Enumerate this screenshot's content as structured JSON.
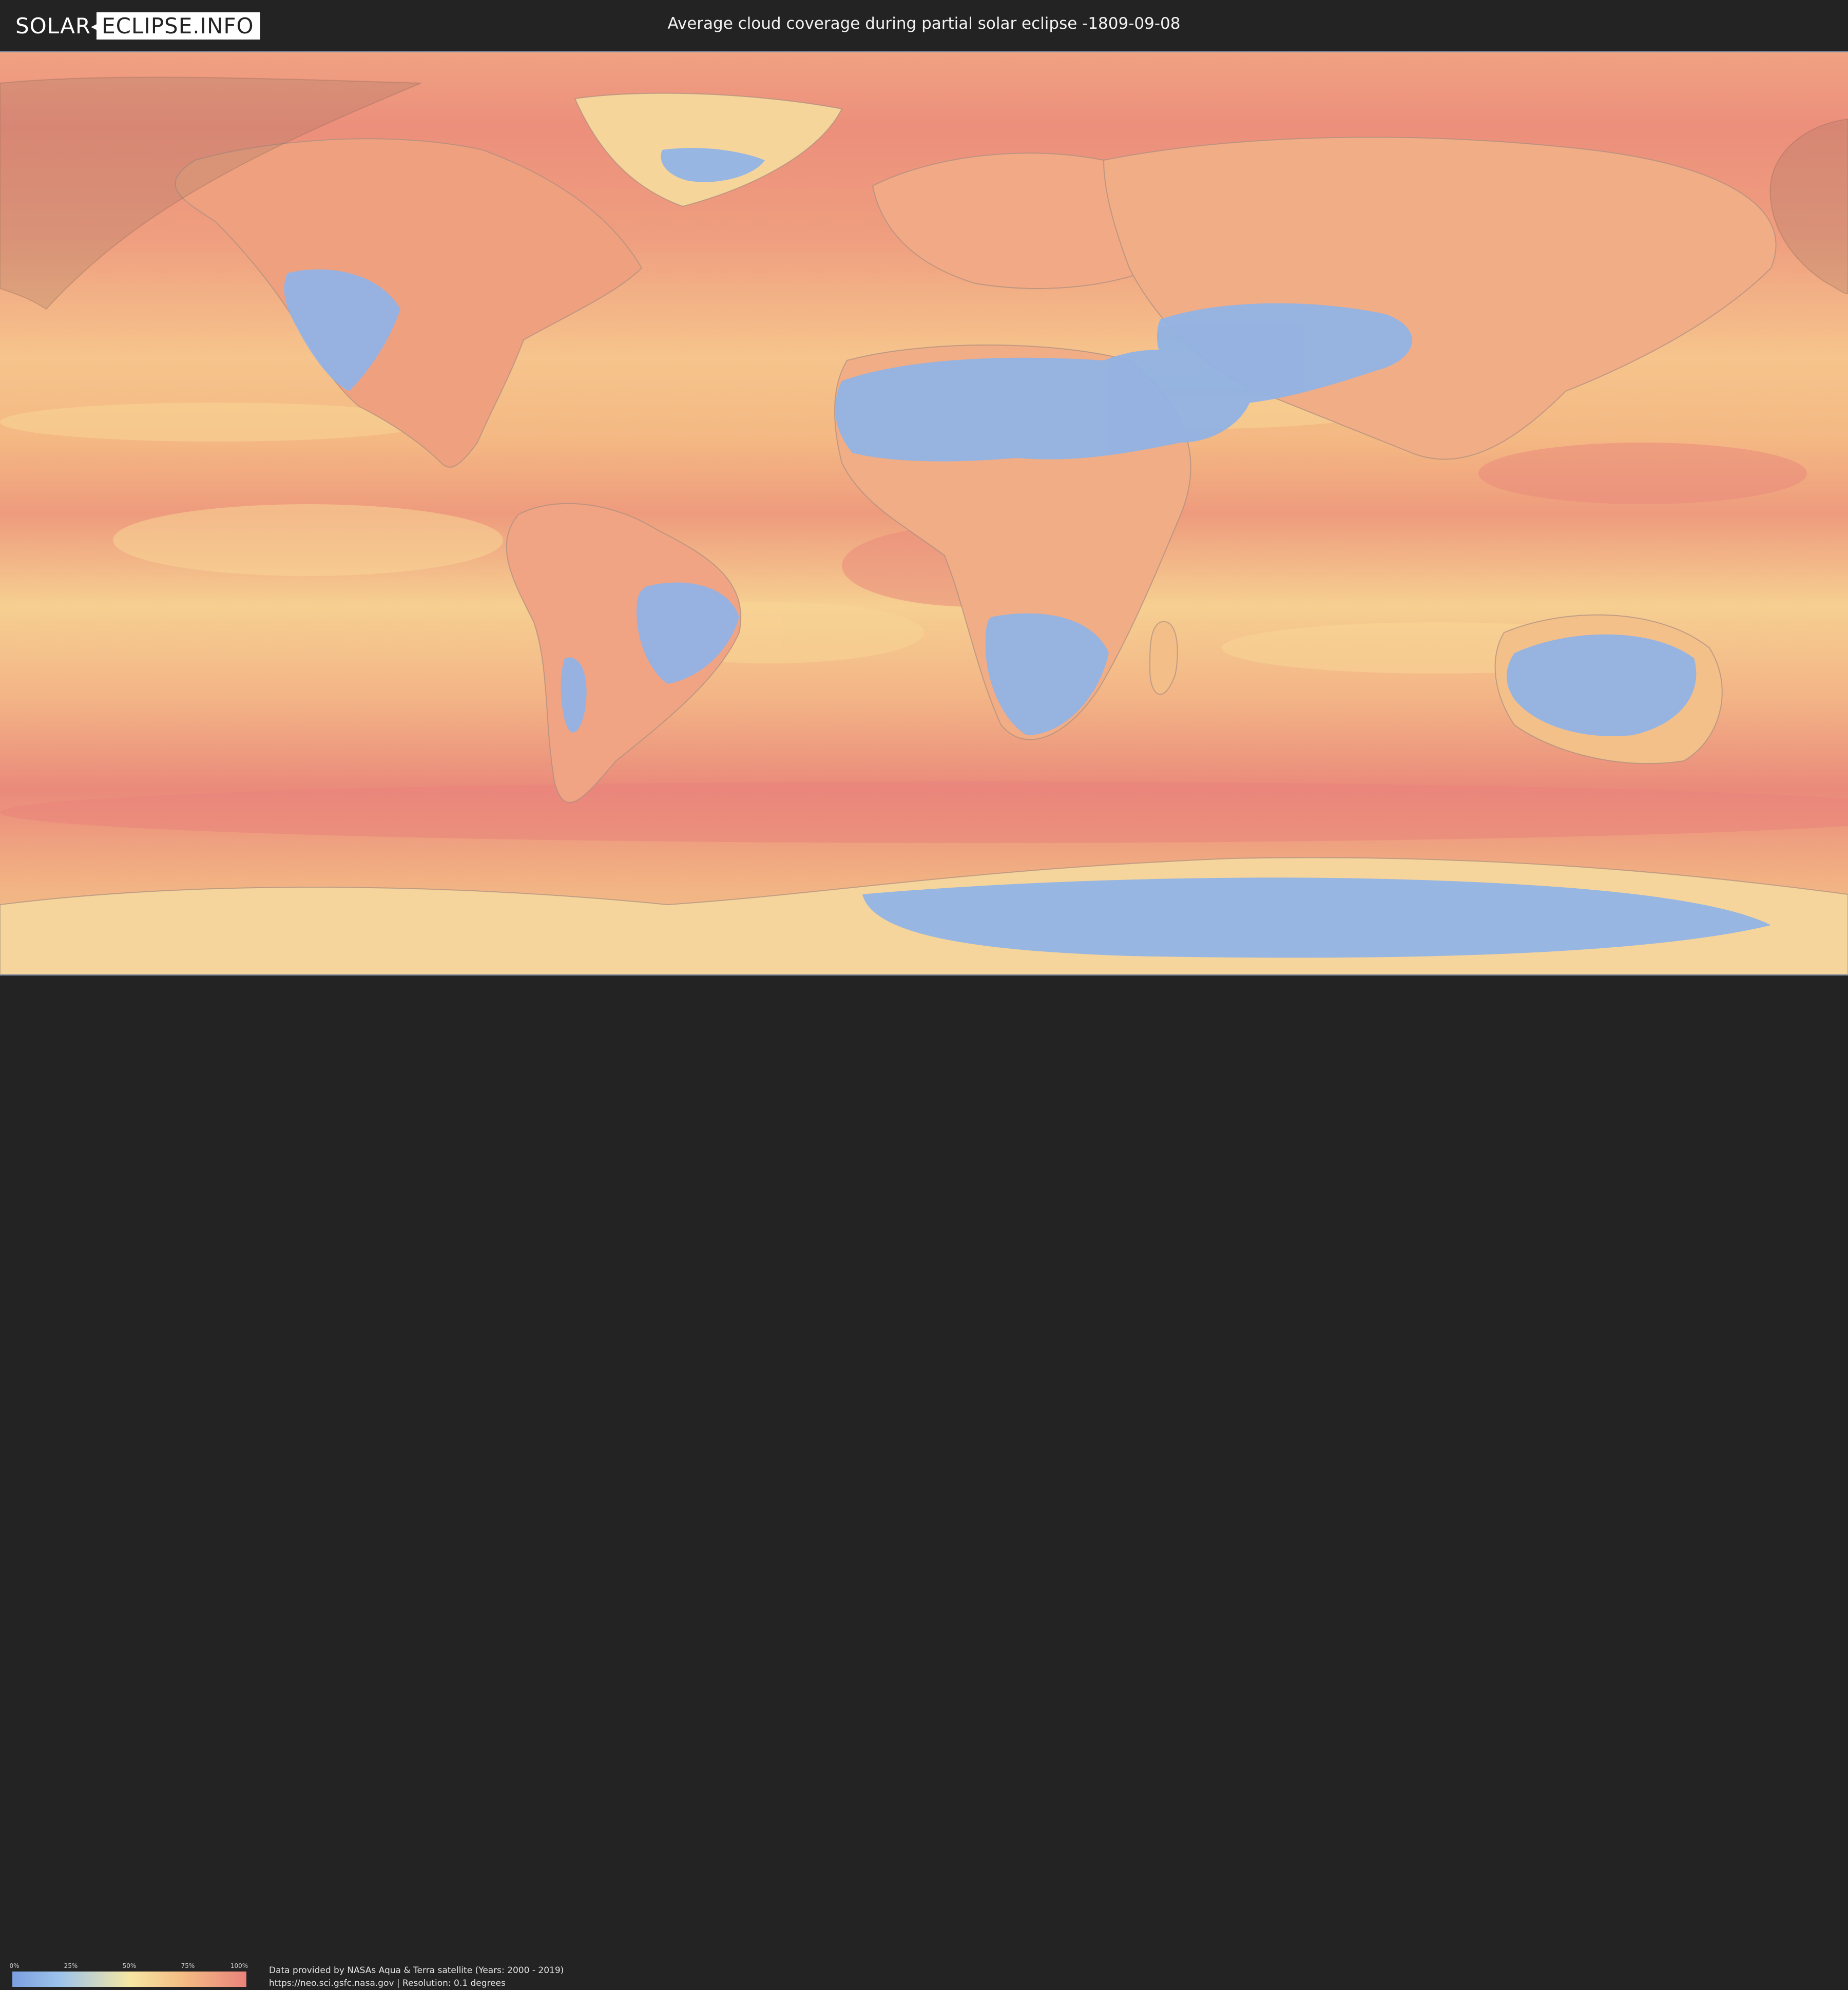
{
  "header": {
    "logo_part1": "SOLAR",
    "logo_part2": "ECLIPSE.INFO",
    "title": "Average cloud coverage during partial solar eclipse -1809-09-08"
  },
  "map": {
    "projection": "equirectangular",
    "layer": "cloud-coverage",
    "eclipse_visibility_overlay": "partial eclipse zone"
  },
  "legend": {
    "ticks": [
      "0%",
      "25%",
      "50%",
      "75%",
      "100%"
    ],
    "colors": [
      "#7b9fe0",
      "#9cc3ec",
      "#f5e6a4",
      "#f4be84",
      "#e9837b"
    ]
  },
  "footer": {
    "credit_line1": "Data provided by NASAs Aqua & Terra satellite (Years: 2000 - 2019)",
    "credit_line2": "https://neo.sci.gsfc.nasa.gov | Resolution: 0.1 degrees"
  }
}
